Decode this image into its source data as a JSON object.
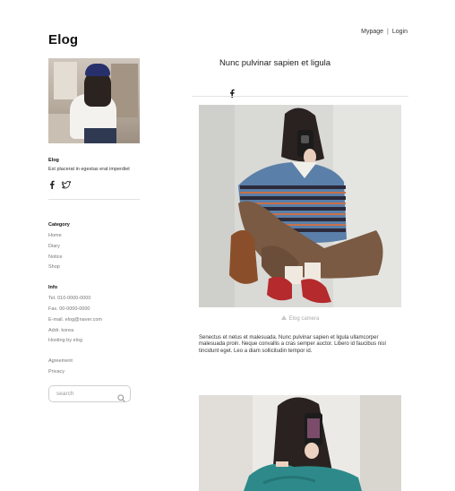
{
  "header": {
    "mypage_label": "Mypage",
    "separator": "|",
    "login_label": "Login"
  },
  "sidebar": {
    "logo": "Elog",
    "profile": {
      "name": "Elog",
      "description": "Est placerat in egestas erat imperdiet"
    },
    "social_icons": [
      "facebook-icon",
      "twitter-icon"
    ],
    "category": {
      "title": "Category",
      "items": [
        "Home",
        "Diary",
        "Notice",
        "Shop"
      ]
    },
    "info": {
      "title": "Info",
      "lines": [
        "Tel. 010-0000-0000",
        "Fax. 00-0000-0000",
        "E-mail. elog@naver.com",
        "Addr. korea",
        "Hosting by elog"
      ]
    },
    "links": [
      "Agreement",
      "Privacy"
    ],
    "search": {
      "placeholder": "search"
    }
  },
  "post": {
    "title": "Nunc pulvinar sapien et ligula",
    "caption": "Elog camera",
    "body": "Senectus et netus et malesuada. Nunc pulvinar sapien et ligula ullamcorper malesuada proin. Neque convallis a cras semper auctor. Libero id faucibus nisl tincidunt eget. Leo a diam sollicitudin tempor id."
  }
}
